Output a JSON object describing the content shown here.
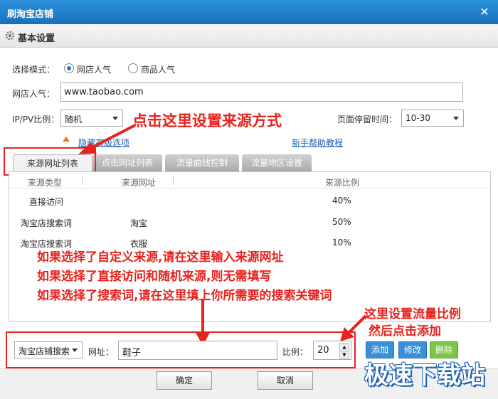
{
  "window": {
    "title": "刷淘宝店铺"
  },
  "section": {
    "title": "基本设置"
  },
  "mode": {
    "label": "选择模式：",
    "options": [
      "网店人气",
      "商品人气"
    ]
  },
  "shop": {
    "label": "网店人气：",
    "value": "www.taobao.com"
  },
  "ippv": {
    "label": "IP/PV比例：",
    "value": "随机"
  },
  "stay": {
    "label": "页面停留时间：",
    "value": "10-30"
  },
  "links": {
    "advanced": "隐藏高级选项",
    "help": "新手帮助教程"
  },
  "tabs": [
    "来源网址列表",
    "点击网址列表",
    "流量曲线控制",
    "流量地区设置"
  ],
  "table": {
    "headers": [
      "来源类型",
      "来源网址",
      "来源比例"
    ],
    "rows": [
      [
        "直接访问",
        "",
        "40%"
      ],
      [
        "淘宝店搜索词",
        "淘宝",
        "50%"
      ],
      [
        "淘宝店搜索词",
        "衣服",
        "10%"
      ]
    ]
  },
  "bottom": {
    "type_value": "淘宝店铺搜索",
    "url_label": "网址：",
    "url_value": "鞋子",
    "ratio_label": "比例：",
    "ratio_value": "20",
    "add": "添加",
    "edit": "修改",
    "delete": "删除"
  },
  "footer": {
    "ok": "确定",
    "cancel": "取消"
  },
  "annotations": {
    "top": "点击这里设置来源方式",
    "line1": "如果选择了自定义来源,请在这里输入来源网址",
    "line2": "如果选择了直接访问和随机来源,则无需填写",
    "line3": "如果选择了搜索词,请在这里填上你所需要的搜索关键词",
    "right1": "这里设置流量比例",
    "right2": "然后点击添加"
  },
  "watermark": "极速下载站",
  "colors": {
    "titlebar": "#1a6fb8",
    "annotation": "#e8221c",
    "add_btn": "#3a8fd6",
    "edit_btn": "#3a8fd6",
    "delete_btn": "#7cc44a"
  }
}
